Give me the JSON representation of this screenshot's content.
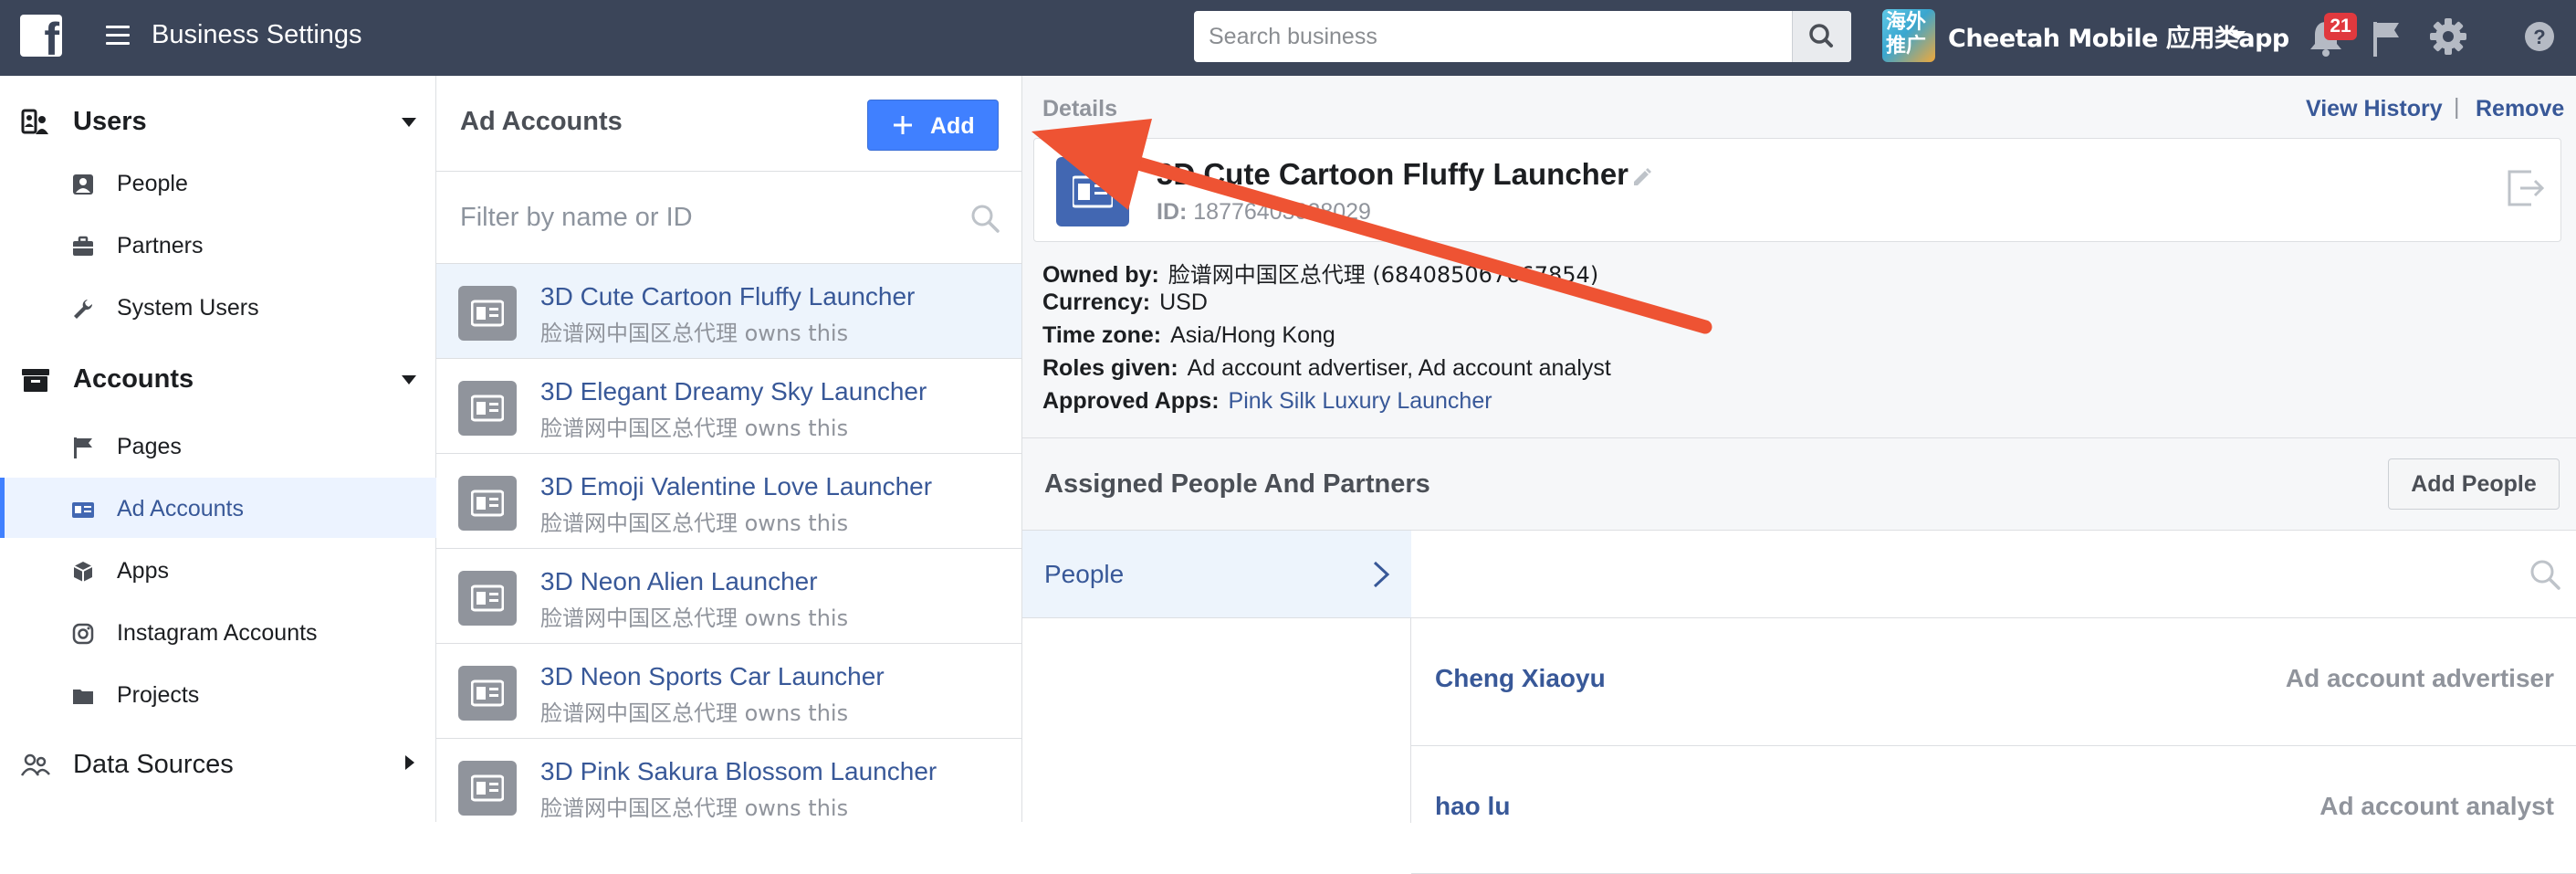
{
  "topbar": {
    "app_title": "Business Settings",
    "search_placeholder": "Search business",
    "business_avatar_line1": "海外",
    "business_avatar_line2": "推广",
    "business_name": "Cheetah Mobile 应用类app",
    "notification_count": "21",
    "icons": [
      "facebook-logo",
      "hamburger-menu-icon",
      "search-icon",
      "bell-icon",
      "flag-icon",
      "gear-icon",
      "help-icon"
    ]
  },
  "sidebar": {
    "sections": [
      {
        "label": "Users",
        "icon": "users-icon",
        "expanded": true,
        "items": [
          {
            "label": "People",
            "icon": "person-icon"
          },
          {
            "label": "Partners",
            "icon": "briefcase-icon"
          },
          {
            "label": "System Users",
            "icon": "wrench-icon"
          }
        ]
      },
      {
        "label": "Accounts",
        "icon": "archive-icon",
        "expanded": true,
        "items": [
          {
            "label": "Pages",
            "icon": "flag-icon"
          },
          {
            "label": "Ad Accounts",
            "icon": "ad-account-icon",
            "active": true
          },
          {
            "label": "Apps",
            "icon": "cube-icon"
          },
          {
            "label": "Instagram Accounts",
            "icon": "instagram-icon"
          },
          {
            "label": "Projects",
            "icon": "folder-icon"
          }
        ]
      },
      {
        "label": "Data Sources",
        "icon": "people-group-icon",
        "expanded": false,
        "items": []
      }
    ]
  },
  "ad_accounts_panel": {
    "title": "Ad Accounts",
    "add_label": "Add",
    "filter_placeholder": "Filter by name or ID",
    "accounts": [
      {
        "name": "3D Cute Cartoon Fluffy Launcher",
        "owner": "脸谱网中国区总代理 owns this",
        "selected": true
      },
      {
        "name": "3D Elegant Dreamy Sky Launcher",
        "owner": "脸谱网中国区总代理 owns this"
      },
      {
        "name": "3D Emoji Valentine Love Launcher",
        "owner": "脸谱网中国区总代理 owns this"
      },
      {
        "name": "3D Neon Alien Launcher",
        "owner": "脸谱网中国区总代理 owns this"
      },
      {
        "name": "3D Neon Sports Car Launcher",
        "owner": "脸谱网中国区总代理 owns this"
      },
      {
        "name": "3D Pink Sakura Blossom Launcher",
        "owner": "脸谱网中国区总代理 owns this"
      }
    ]
  },
  "details": {
    "label": "Details",
    "view_history": "View History",
    "separator": "|",
    "remove": "Remove",
    "account_title": "3D Cute Cartoon Fluffy Launcher",
    "id_label": "ID:",
    "id_value": "18776403028029",
    "owned_by_label": "Owned by:",
    "owned_by_value": "脸谱网中国区总代理 (684085067667854)",
    "currency_label": "Currency:",
    "currency_value": "USD",
    "timezone_label": "Time zone:",
    "timezone_value": "Asia/Hong Kong",
    "roles_label": "Roles given:",
    "roles_value": "Ad account advertiser, Ad account analyst",
    "apps_label": "Approved Apps:",
    "apps_value": "Pink Silk Luxury Launcher"
  },
  "assigned": {
    "title": "Assigned People And Partners",
    "add_people_label": "Add People",
    "tab_label": "People",
    "people": [
      {
        "name": "Cheng Xiaoyu",
        "role": "Ad account advertiser"
      },
      {
        "name": "hao lu",
        "role": "Ad account analyst"
      }
    ]
  },
  "colors": {
    "topbar": "#3b4559",
    "accent": "#4080ff",
    "link": "#385898",
    "annotation_arrow": "#ee5333"
  }
}
